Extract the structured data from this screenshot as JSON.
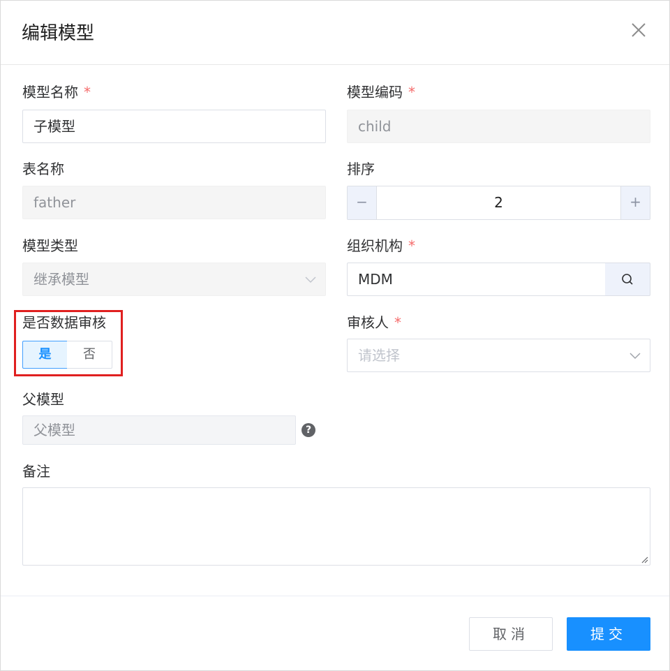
{
  "dialog": {
    "title": "编辑模型",
    "close_icon": "close-icon"
  },
  "form": {
    "model_name": {
      "label": "模型名称",
      "required": "*",
      "value": "子模型"
    },
    "model_code": {
      "label": "模型编码",
      "required": "*",
      "value": "child"
    },
    "table_name": {
      "label": "表名称",
      "value": "father"
    },
    "sort": {
      "label": "排序",
      "value": "2",
      "minus": "−",
      "plus": "+"
    },
    "model_type": {
      "label": "模型类型",
      "value": "继承模型"
    },
    "org": {
      "label": "组织机构",
      "required": "*",
      "value": "MDM"
    },
    "data_audit": {
      "label": "是否数据审核",
      "options": [
        "是",
        "否"
      ],
      "selected": "是"
    },
    "auditor": {
      "label": "审核人",
      "required": "*",
      "placeholder": "请选择"
    },
    "parent_model": {
      "label": "父模型",
      "value": "父模型",
      "help": "?"
    },
    "remark": {
      "label": "备注",
      "value": ""
    }
  },
  "footer": {
    "cancel_label": "取消",
    "submit_label": "提交"
  },
  "colors": {
    "primary": "#1890ff",
    "required": "#f56c6c",
    "highlight_border": "#e02020"
  }
}
